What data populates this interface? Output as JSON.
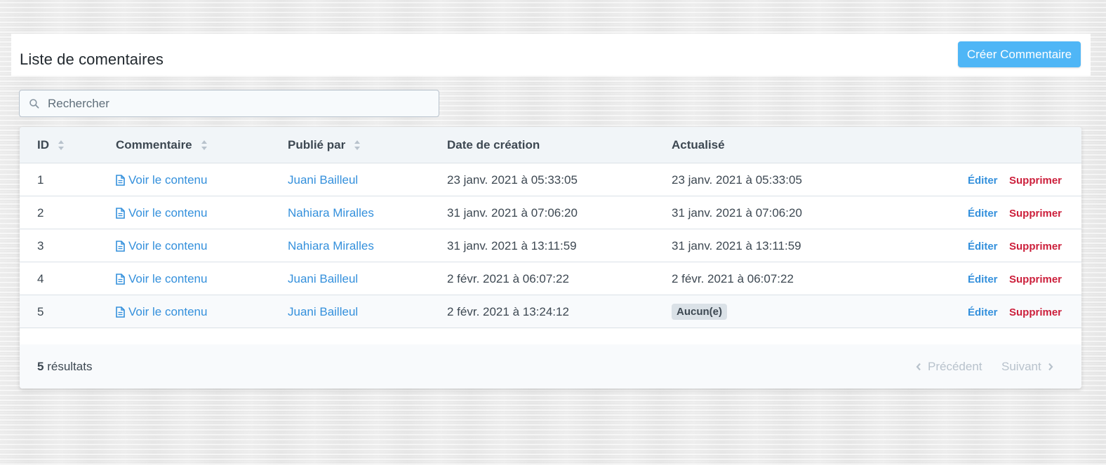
{
  "header": {
    "title": "Liste de comentaires",
    "create_label": "Créer Commentaire"
  },
  "search": {
    "placeholder": "Rechercher"
  },
  "table": {
    "columns": {
      "id": "ID",
      "comment": "Commentaire",
      "published_by": "Publié par",
      "created": "Date de création",
      "updated": "Actualisé"
    },
    "actions": {
      "edit": "Éditer",
      "delete": "Supprimer"
    },
    "rows": [
      {
        "id": "1",
        "comment": "Voir le contenu",
        "author": "Juani Bailleul",
        "created": "23 janv. 2021 à 05:33:05",
        "updated": "23 janv. 2021 à 05:33:05"
      },
      {
        "id": "2",
        "comment": "Voir le contenu",
        "author": "Nahiara Miralles",
        "created": "31 janv. 2021 à 07:06:20",
        "updated": "31 janv. 2021 à 07:06:20"
      },
      {
        "id": "3",
        "comment": "Voir le contenu",
        "author": "Nahiara Miralles",
        "created": "31 janv. 2021 à 13:11:59",
        "updated": "31 janv. 2021 à 13:11:59"
      },
      {
        "id": "4",
        "comment": "Voir le contenu",
        "author": "Juani Bailleul",
        "created": "2 févr. 2021 à 06:07:22",
        "updated": "2 févr. 2021 à 06:07:22"
      },
      {
        "id": "5",
        "comment": "Voir le contenu",
        "author": "Juani Bailleul",
        "created": "2 févr. 2021 à 13:24:12",
        "updated_badge": "Aucun(e)"
      }
    ]
  },
  "footer": {
    "count": "5",
    "count_label": "résultats",
    "prev_label": "Précédent",
    "next_label": "Suivant"
  },
  "colors": {
    "primary_button": "#4fb6f6",
    "link": "#3490dc",
    "danger": "#cc1f3b"
  }
}
